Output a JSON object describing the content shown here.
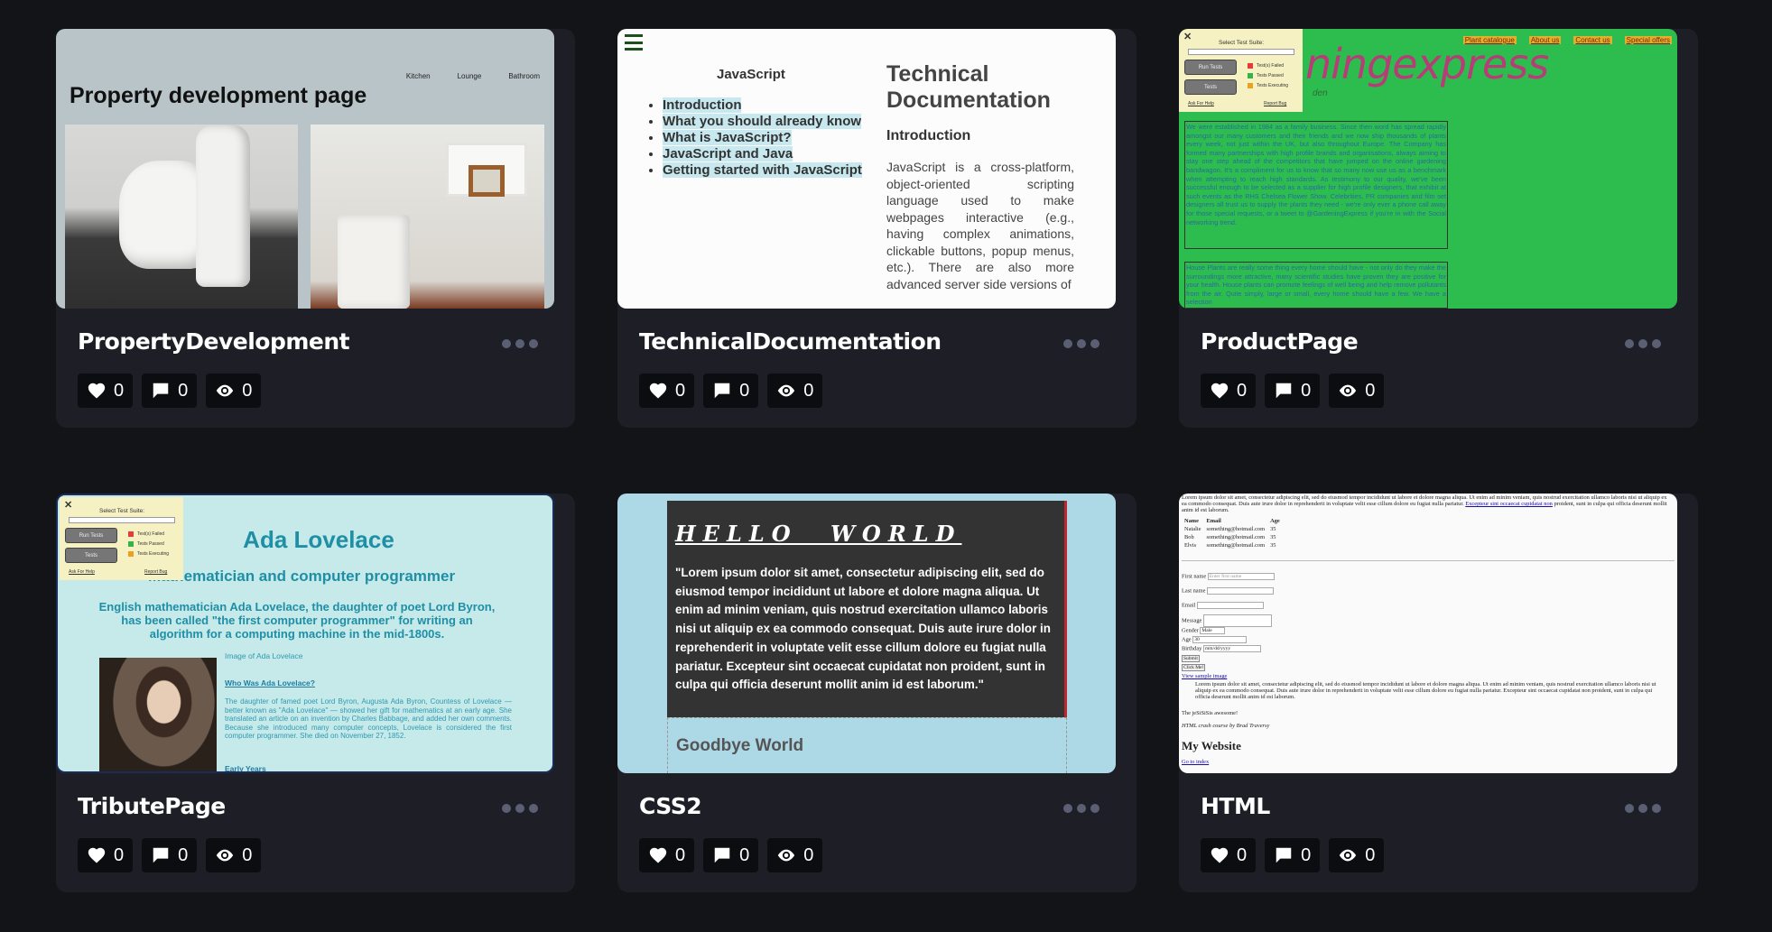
{
  "cards": [
    {
      "title": "PropertyDevelopment",
      "likes": "0",
      "comments": "0",
      "views": "0",
      "preview": {
        "heading": "Property development page",
        "nav": [
          "Kitchen",
          "Lounge",
          "Bathroom"
        ]
      }
    },
    {
      "title": "TechnicalDocumentation",
      "likes": "0",
      "comments": "0",
      "views": "0",
      "preview": {
        "sidebar_title": "JavaScript",
        "nav": [
          "Introduction",
          "What you should already know",
          "What is JavaScript?",
          "JavaScript and Java",
          "Getting started with JavaScript"
        ],
        "heading": "Technical Documentation",
        "section": "Introduction",
        "body": "JavaScript is a cross-platform, object-oriented scripting language used to make webpages interactive (e.g., having complex animations, clickable buttons, popup menus, etc.). There are also more advanced server side versions of"
      }
    },
    {
      "title": "ProductPage",
      "likes": "0",
      "comments": "0",
      "views": "0",
      "preview": {
        "brand": "ningexpress",
        "brand_sub": "den",
        "nav": [
          "Plant catalogue",
          "About us",
          "Contact us",
          "Special offers"
        ],
        "para1": "We were established in 1984 as a family business. Since then word has spread rapidly amongst our many customers and their friends and we now ship thousands of plants every week, not just within the UK, but also throughout Europe. The Company has formed many partnerships with high profile brands and organisations, always aiming to stay one step ahead of the competitors that have jumped on the online gardening bandwagon. It's a compliment for us to know that so many now use us as a benchmark when attempting to reach high standards. As testimony to our quality, we've been successful enough to be selected as a supplier for high profile designers, that exhibit at such events as the RHS Chelsea Flower Show. Celebrities, PR companies and film set designers all trust us to supply the plants they need - we're only ever a phone call away for those special requests, or a tweet to @GardeningExpress if you're in with the Social networking trend.",
        "para2": "House Plants are really some thing every home should have - not only do they make the surroundings more attractive, many scientific studies have proven they are positive for your health. House plants can promote feelings of well being and help remove pollutants from the air. Quite simply, large or small, every home should have a few. We have a selection",
        "test_suite": {
          "select_label": "Select Test Suite:",
          "run_button": "Run Tests",
          "tests_button": "Tests",
          "legend": [
            "Test(s) Failed",
            "Tests Passed",
            "Tests Executing"
          ],
          "ask_link": "Ask For Help",
          "report_link": "Report Bug"
        }
      }
    },
    {
      "title": "TributePage",
      "likes": "0",
      "comments": "0",
      "views": "0",
      "preview": {
        "heading": "Ada Lovelace",
        "subheading": "Mathematician and computer programmer",
        "lead": "English mathematician Ada Lovelace, the daughter of poet Lord Byron, has been called \"the first computer programmer\" for writing an algorithm for a computing machine in the mid-1800s.",
        "image_caption": "Image of Ada Lovelace",
        "who_link": "Who Was Ada Lovelace?",
        "bio": "The daughter of famed poet Lord Byron, Augusta Ada Byron, Countess of Lovelace — better known as \"Ada Lovelace\" — showed her gift for mathematics at an early age. She translated an article on an invention by Charles Babbage, and added her own comments. Because she introduced many computer concepts, Lovelace is considered the first computer programmer. She died on November 27, 1852.",
        "early_link": "Early Years",
        "test_suite": {
          "select_label": "Select Test Suite:",
          "run_button": "Run Tests",
          "tests_button": "Tests",
          "legend": [
            "Test(s) Failed",
            "Tests Passed",
            "Tests Executing"
          ],
          "ask_link": "Ask For Help",
          "report_link": "Report Bug"
        }
      }
    },
    {
      "title": "CSS2",
      "likes": "0",
      "comments": "0",
      "views": "0",
      "preview": {
        "hello": "HELLO WORLD",
        "quote": "\"Lorem ipsum dolor sit amet, consectetur adipiscing elit, sed do eiusmod tempor incididunt ut labore et dolore magna aliqua. Ut enim ad minim veniam, quis nostrud exercitation ullamco laboris nisi ut aliquip ex ea commodo consequat. Duis aute irure dolor in reprehenderit in voluptate velit esse cillum dolore eu fugiat nulla pariatur. Excepteur sint occaecat cupidatat non proident, sunt in culpa qui officia deserunt mollit anim id est laborum.\"",
        "goodbye": "Goodbye World"
      }
    },
    {
      "title": "HTML",
      "likes": "0",
      "comments": "0",
      "views": "0",
      "preview": {
        "lorem": "Lorem ipsum dolor sit amet, consectetur adipiscing elit, sed do eiusmod tempor incididunt ut labore et dolore magna aliqua. Ut enim ad minim veniam, quis nostrud exercitation ullamco laboris nisi ut aliquip ex ea commodo consequat. Duis aute irure dolor in reprehenderit in voluptate velit esse cillum dolore eu fugiat nulla pariatur.",
        "lorem_link": "Excepteur sint occaecat cupidatat non",
        "lorem_tail": "proident, sunt in culpa qui officia deserunt mollit anim id est laborum.",
        "table_headers": [
          "Name",
          "Email",
          "Age"
        ],
        "table_rows": [
          [
            "Natalie",
            "something@hotmail.com",
            "35"
          ],
          [
            "Bob",
            "something@hotmail.com",
            "35"
          ],
          [
            "Elvis",
            "something@hotmail.com",
            "35"
          ]
        ],
        "first_name_label": "First name",
        "first_name_placeholder": "Enter first name",
        "last_name_label": "Last name",
        "email_label": "Email",
        "message_label": "Message",
        "gender_label": "Gender",
        "gender_value": "Male",
        "age_label": "Age",
        "age_value": "30",
        "birthday_label": "Birthday",
        "birthday_placeholder": "mm/dd/yyyy",
        "submit": "Submit",
        "click_me": "Click Me!",
        "image_link": "View sample image",
        "lorem2": "Lorem ipsum dolor sit amet, consectetur adipiscing elit, sed do eiusmod tempor incididunt ut labore et dolore magna aliqua. Ut enim ad minim veniam, quis nostrud exercitation ullamco laboris nisi ut aliquip ex ea commodo consequat. Duis aute irure dolor in reprehenderit in voluptate velit esse cillum dolore eu fugiat nulla pariatur. Excepteur sint occaecat cupidatat non proident, sunt in culpa qui officia deserunt mollit anim id est laborum.",
        "awesome": "The jeSiSiSis awesome!",
        "credit": "HTML crash course by Brad Traversy",
        "site_title": "My Website",
        "goto": "Go to index"
      }
    }
  ],
  "colors": {
    "background": "#131417",
    "card": "#1e1f26",
    "stat_bg": "#0c0d10",
    "more_dots": "#5a5f73"
  },
  "icons": {
    "likes": "heart-icon",
    "comments": "comment-icon",
    "views": "eye-icon",
    "more": "more-icon"
  }
}
